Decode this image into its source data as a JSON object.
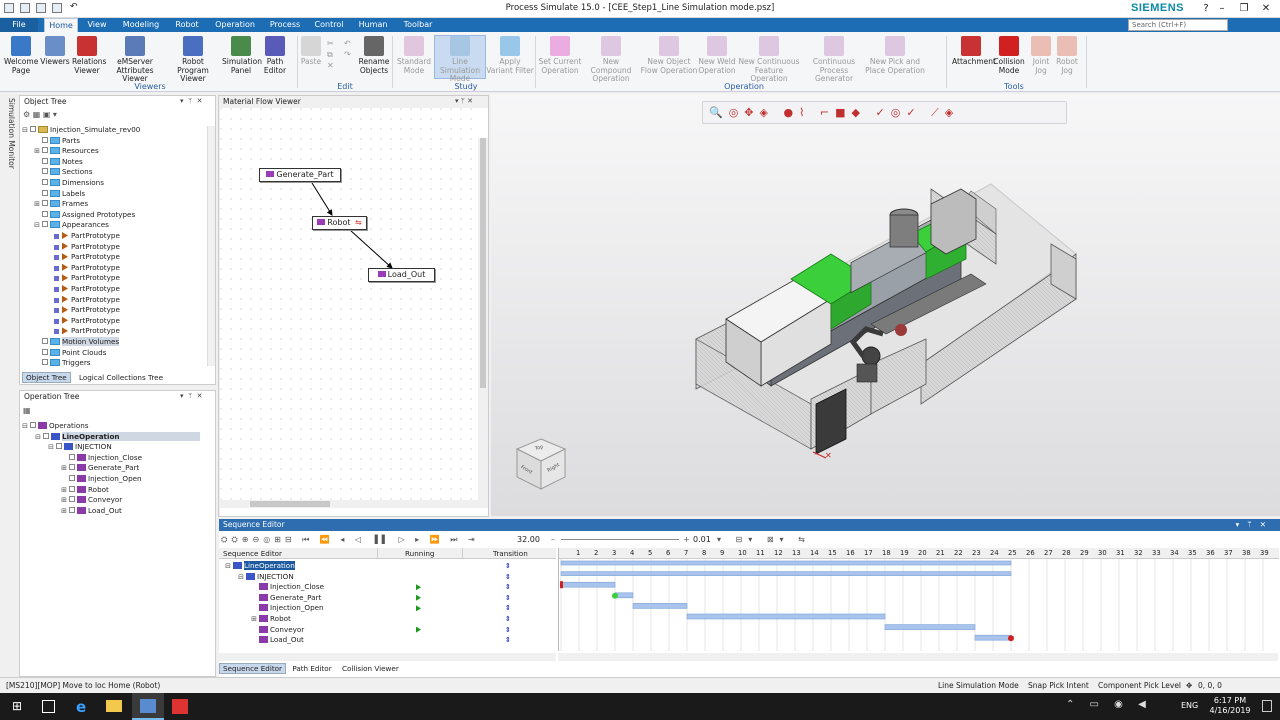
{
  "window": {
    "title": "Process Simulate 15.0 - [CEE_Step1_Line Simulation mode.psz]",
    "brand": "SIEMENS",
    "search_placeholder": "Search (Ctrl+F)",
    "controls": [
      "?",
      "–",
      "❐",
      "✕"
    ]
  },
  "menu": {
    "file": "File",
    "tabs": [
      "Home",
      "View",
      "Modeling",
      "Robot",
      "Operation",
      "Process",
      "Control",
      "Human",
      "Toolbar"
    ]
  },
  "ribbon": {
    "buttons": [
      {
        "label1": "Welcome",
        "label2": "Page",
        "color": "#3a78c8"
      },
      {
        "label1": "Viewers",
        "label2": "",
        "color": "#6a8fc8"
      },
      {
        "label1": "Relations",
        "label2": "Viewer",
        "color": "#c83232"
      },
      {
        "label1": "eMServer",
        "label2": "Attributes Viewer",
        "color": "#5a7ab8"
      },
      {
        "label1": "Robot Program",
        "label2": "Viewer",
        "color": "#4a6fc0"
      },
      {
        "label1": "Simulation",
        "label2": "Panel",
        "color": "#4a8a4a"
      },
      {
        "label1": "Path",
        "label2": "Editor",
        "color": "#5a5ab8"
      },
      {
        "label1": "Paste",
        "label2": "",
        "color": "#bbbbbb"
      },
      {
        "label1": "Rename",
        "label2": "Objects",
        "color": "#666666"
      },
      {
        "label1": "Standard",
        "label2": "Mode",
        "color": "#d0a0c8"
      },
      {
        "label1": "Line Simulation",
        "label2": "Mode",
        "color": "#8ab4d8"
      },
      {
        "label1": "Apply",
        "label2": "Variant Filter",
        "color": "#4aa0e0"
      },
      {
        "label1": "Set Current",
        "label2": "Operation",
        "color": "#e070d0"
      },
      {
        "label1": "New Compound",
        "label2": "Operation",
        "color": "#c8a0d0"
      },
      {
        "label1": "New Object",
        "label2": "Flow Operation",
        "color": "#c8a0d0"
      },
      {
        "label1": "New Weld",
        "label2": "Operation",
        "color": "#c8a0d0"
      },
      {
        "label1": "New Continuous",
        "label2": "Feature Operation",
        "color": "#c8a0d0"
      },
      {
        "label1": "Continuous",
        "label2": "Process Generator",
        "color": "#c8a0d0"
      },
      {
        "label1": "New Pick and",
        "label2": "Place Operation",
        "color": "#c8a0d0"
      },
      {
        "label1": "Attachment",
        "label2": "",
        "color": "#c83232"
      },
      {
        "label1": "Collision",
        "label2": "Mode",
        "color": "#d02020"
      },
      {
        "label1": "Joint",
        "label2": "Jog",
        "color": "#e09080"
      },
      {
        "label1": "Robot",
        "label2": "Jog",
        "color": "#e09080"
      }
    ],
    "groups": [
      "Viewers",
      "Edit",
      "Study",
      "Operation",
      "Tools"
    ]
  },
  "object_tree": {
    "title": "Object Tree",
    "side_tab": "Simulation Monitor",
    "rows": [
      {
        "label": "Injection_Simulate_rev00",
        "level": 0,
        "kind": "root"
      },
      {
        "label": "Parts",
        "level": 1,
        "kind": "folder"
      },
      {
        "label": "Resources",
        "level": 1,
        "kind": "folder"
      },
      {
        "label": "Notes",
        "level": 1,
        "kind": "folder"
      },
      {
        "label": "Sections",
        "level": 1,
        "kind": "folder"
      },
      {
        "label": "Dimensions",
        "level": 1,
        "kind": "folder"
      },
      {
        "label": "Labels",
        "level": 1,
        "kind": "folder"
      },
      {
        "label": "Frames",
        "level": 1,
        "kind": "folder"
      },
      {
        "label": "Assigned Prototypes",
        "level": 1,
        "kind": "folder"
      },
      {
        "label": "Appearances",
        "level": 1,
        "kind": "folder"
      },
      {
        "label": "PartPrototype",
        "level": 2,
        "kind": "app"
      },
      {
        "label": "PartPrototype",
        "level": 2,
        "kind": "app"
      },
      {
        "label": "PartPrototype",
        "level": 2,
        "kind": "app"
      },
      {
        "label": "PartPrototype",
        "level": 2,
        "kind": "app"
      },
      {
        "label": "PartPrototype",
        "level": 2,
        "kind": "app"
      },
      {
        "label": "PartPrototype",
        "level": 2,
        "kind": "app"
      },
      {
        "label": "PartPrototype",
        "level": 2,
        "kind": "app"
      },
      {
        "label": "PartPrototype",
        "level": 2,
        "kind": "app"
      },
      {
        "label": "PartPrototype",
        "level": 2,
        "kind": "app"
      },
      {
        "label": "PartPrototype",
        "level": 2,
        "kind": "app"
      },
      {
        "label": "Motion Volumes",
        "level": 1,
        "kind": "folder"
      },
      {
        "label": "Point Clouds",
        "level": 1,
        "kind": "folder"
      },
      {
        "label": "Triggers",
        "level": 1,
        "kind": "folder"
      }
    ],
    "tabs": [
      "Object Tree",
      "Logical Collections Tree"
    ]
  },
  "operation_tree": {
    "title": "Operation Tree",
    "rows": [
      {
        "label": "Operations",
        "level": 0
      },
      {
        "label": "LineOperation",
        "level": 1
      },
      {
        "label": "INJECTION",
        "level": 2
      },
      {
        "label": "Injection_Close",
        "level": 3
      },
      {
        "label": "Generate_Part",
        "level": 3
      },
      {
        "label": "Injection_Open",
        "level": 3
      },
      {
        "label": "Robot",
        "level": 3
      },
      {
        "label": "Conveyor",
        "level": 3
      },
      {
        "label": "Load_Out",
        "level": 3
      }
    ]
  },
  "material_flow": {
    "title": "Material Flow Viewer",
    "nodes": [
      "Generate_Part",
      "Robot",
      "Load_Out"
    ]
  },
  "viewcube": {
    "top": "Top",
    "front": "Front",
    "right": "Right"
  },
  "sequence_editor": {
    "title": "Sequence Editor",
    "time": "32.00",
    "step": "0.01",
    "columns": [
      "Sequence Editor",
      "Running",
      "Transition"
    ],
    "ticks": [
      "1",
      "2",
      "3",
      "4",
      "5",
      "6",
      "7",
      "8",
      "9",
      "10",
      "11",
      "12",
      "13",
      "14",
      "15",
      "16",
      "17",
      "18",
      "19",
      "20",
      "21",
      "22",
      "23",
      "24",
      "25",
      "26",
      "27",
      "28",
      "29",
      "30",
      "31",
      "32",
      "33",
      "34",
      "35",
      "36",
      "37",
      "38",
      "39",
      "40"
    ],
    "rows": [
      {
        "label": "LineOperation",
        "level": 0,
        "running": false
      },
      {
        "label": "INJECTION",
        "level": 1,
        "running": false
      },
      {
        "label": "Injection_Close",
        "level": 2,
        "running": true
      },
      {
        "label": "Generate_Part",
        "level": 2,
        "running": true
      },
      {
        "label": "Injection_Open",
        "level": 2,
        "running": true
      },
      {
        "label": "Robot",
        "level": 2,
        "running": false
      },
      {
        "label": "Conveyor",
        "level": 2,
        "running": true
      },
      {
        "label": "Load_Out",
        "level": 2,
        "running": false
      }
    ],
    "gantt": [
      {
        "start": 0,
        "end": 25
      },
      {
        "start": 0,
        "end": 25
      },
      {
        "start": 0,
        "end": 3
      },
      {
        "start": 3,
        "end": 4
      },
      {
        "start": 4,
        "end": 7
      },
      {
        "start": 7,
        "end": 18
      },
      {
        "start": 18,
        "end": 23
      },
      {
        "start": 23,
        "end": 25
      }
    ],
    "tabs": [
      "Sequence Editor",
      "Path Editor",
      "Collision Viewer"
    ]
  },
  "status": {
    "message": "[MS210][MOP] Move to loc Home (Robot)",
    "mode": "Line Simulation Mode",
    "snap": "Snap Pick Intent",
    "pick": "Component Pick Level",
    "coords": "0, 0, 0"
  },
  "taskbar": {
    "time": "6:17 PM",
    "date": "4/16/2019",
    "lang": "ENG"
  },
  "colors": {
    "menu_bg": "#1d6db5",
    "accent_green": "#3ccf3c",
    "gantt_bar": "#a8c4ec"
  }
}
